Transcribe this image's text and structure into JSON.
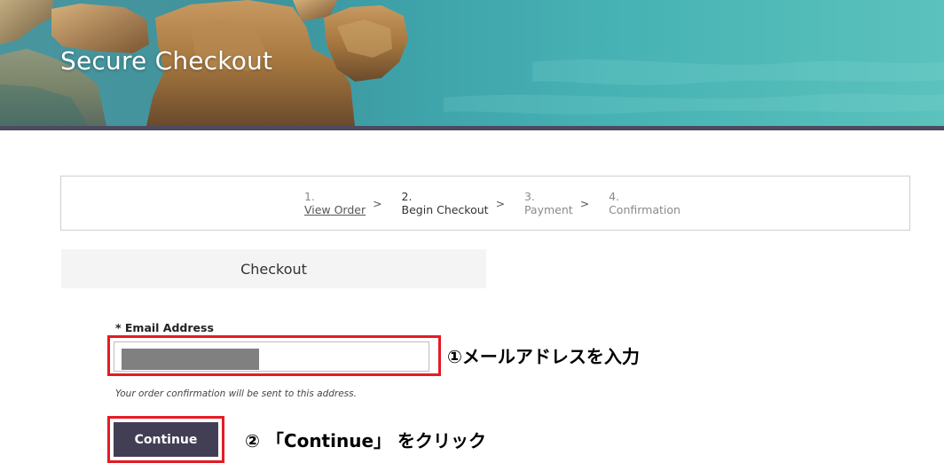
{
  "header": {
    "title": "Secure Checkout",
    "background_image": "coastal-rock-cliffs-and-turquoise-sea"
  },
  "steps": [
    {
      "number": "1.",
      "label": "View Order",
      "state": "link"
    },
    {
      "number": "2.",
      "label": "Begin Checkout",
      "state": "current"
    },
    {
      "number": "3.",
      "label": "Payment",
      "state": "upcoming"
    },
    {
      "number": "4.",
      "label": "Confirmation",
      "state": "upcoming"
    }
  ],
  "step_separator": ">",
  "checkout": {
    "heading": "Checkout",
    "email_label": "* Email Address",
    "email_value": "",
    "email_redacted": true,
    "hint": "Your order confirmation will be sent to this address.",
    "continue_label": "Continue"
  },
  "annotations": {
    "step1": "①メールアドレスを入力",
    "step2": "② 「Continue」 をクリック",
    "highlight_color": "#e51b24"
  },
  "colors": {
    "banner_border": "#4c4a60",
    "button_bg": "#423f55",
    "panel_bg": "#f4f4f4"
  }
}
